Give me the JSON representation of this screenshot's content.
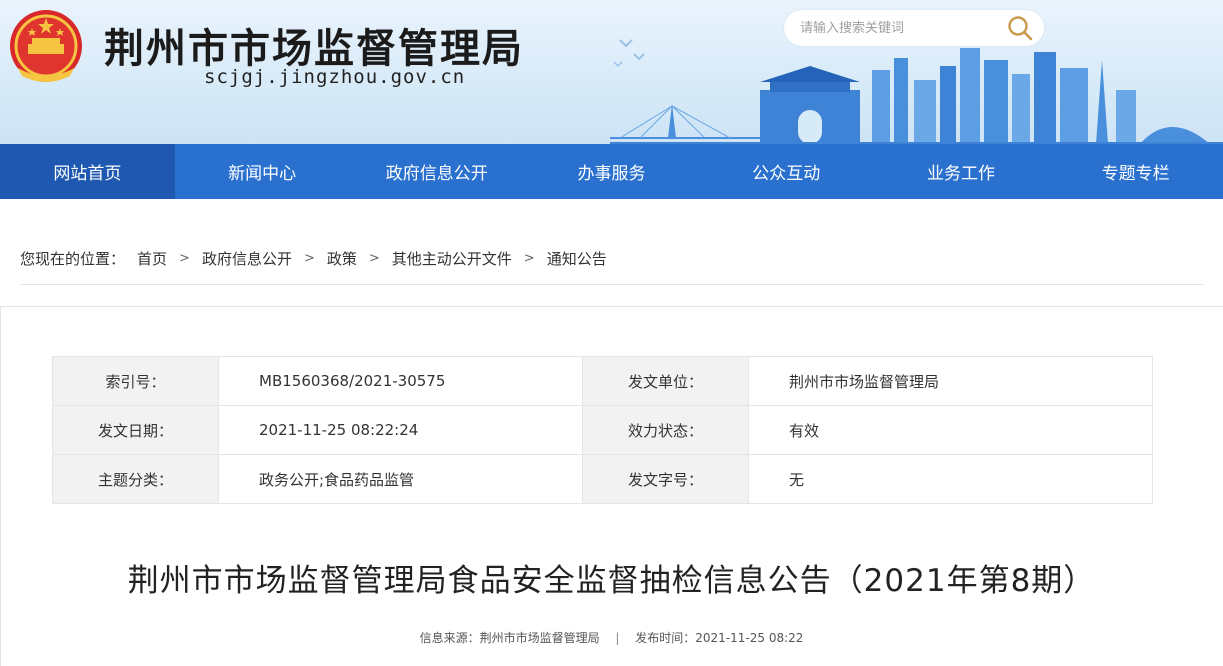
{
  "header": {
    "site_title": "荆州市市场监督管理局",
    "site_domain": "scjgj.jingzhou.gov.cn",
    "search_placeholder": "请输入搜索关键词"
  },
  "nav": {
    "items": [
      {
        "label": "网站首页"
      },
      {
        "label": "新闻中心"
      },
      {
        "label": "政府信息公开"
      },
      {
        "label": "办事服务"
      },
      {
        "label": "公众互动"
      },
      {
        "label": "业务工作"
      },
      {
        "label": "专题专栏"
      }
    ]
  },
  "breadcrumb": {
    "prefix": "您现在的位置：",
    "items": [
      "首页",
      "政府信息公开",
      "政策",
      "其他主动公开文件",
      "通知公告"
    ],
    "separator": ">"
  },
  "meta": {
    "index_label": "索引号：",
    "index_value": "MB1560368/2021-30575",
    "unit_label": "发文单位：",
    "unit_value": "荆州市市场监督管理局",
    "date_label": "发文日期：",
    "date_value": "2021-11-25 08:22:24",
    "status_label": "效力状态：",
    "status_value": "有效",
    "topic_label": "主题分类：",
    "topic_value": "政务公开;食品药品监管",
    "docno_label": "发文字号：",
    "docno_value": "无"
  },
  "article": {
    "title": "荆州市市场监督管理局食品安全监督抽检信息公告（2021年第8期）",
    "source": "信息来源：荆州市市场监督管理局",
    "separator": "|",
    "publish_time": "发布时间：2021-11-25 08:22"
  },
  "colors": {
    "nav_bg": "#2a71cf",
    "nav_active": "#1f58b0",
    "table_key_bg": "#f2f2f2"
  }
}
